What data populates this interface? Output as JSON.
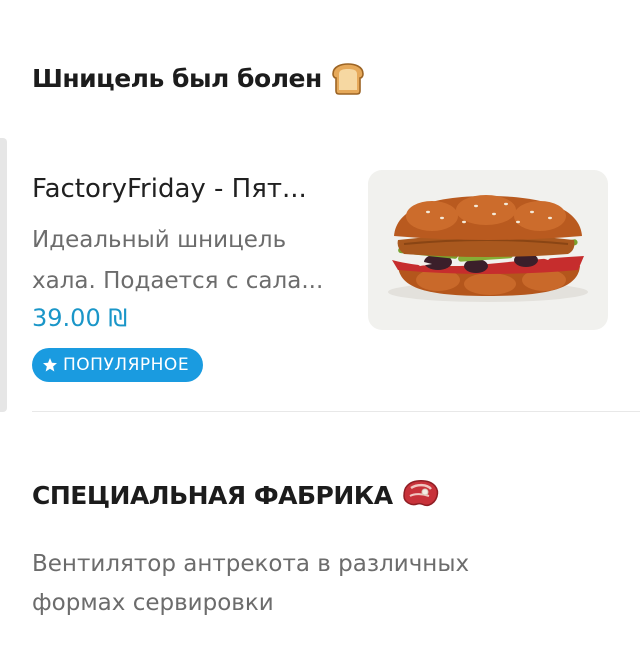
{
  "sections": [
    {
      "title": "Шницель был болен",
      "emoji_icon": "bread-icon",
      "items": [
        {
          "name": "FactoryFriday - Пят...",
          "description_lines": [
            "Идеальный шницель",
            "хала. Подается с сала..."
          ],
          "price": "39.00 ₪",
          "badge": "ПОПУЛЯРНОЕ",
          "badge_icon": "star-icon",
          "image": "schnitzel-sandwich-photo"
        }
      ]
    },
    {
      "title": "СПЕЦИАЛЬНАЯ ФАБРИКА",
      "emoji_icon": "steak-icon",
      "description_lines": [
        "Вентилятор антрекота в различных",
        "формах сервировки"
      ]
    }
  ],
  "colors": {
    "price": "#1a96c8",
    "badge_bg": "#1a9be0",
    "text_primary": "#1c1c1c",
    "text_secondary": "#6c6c6c"
  }
}
